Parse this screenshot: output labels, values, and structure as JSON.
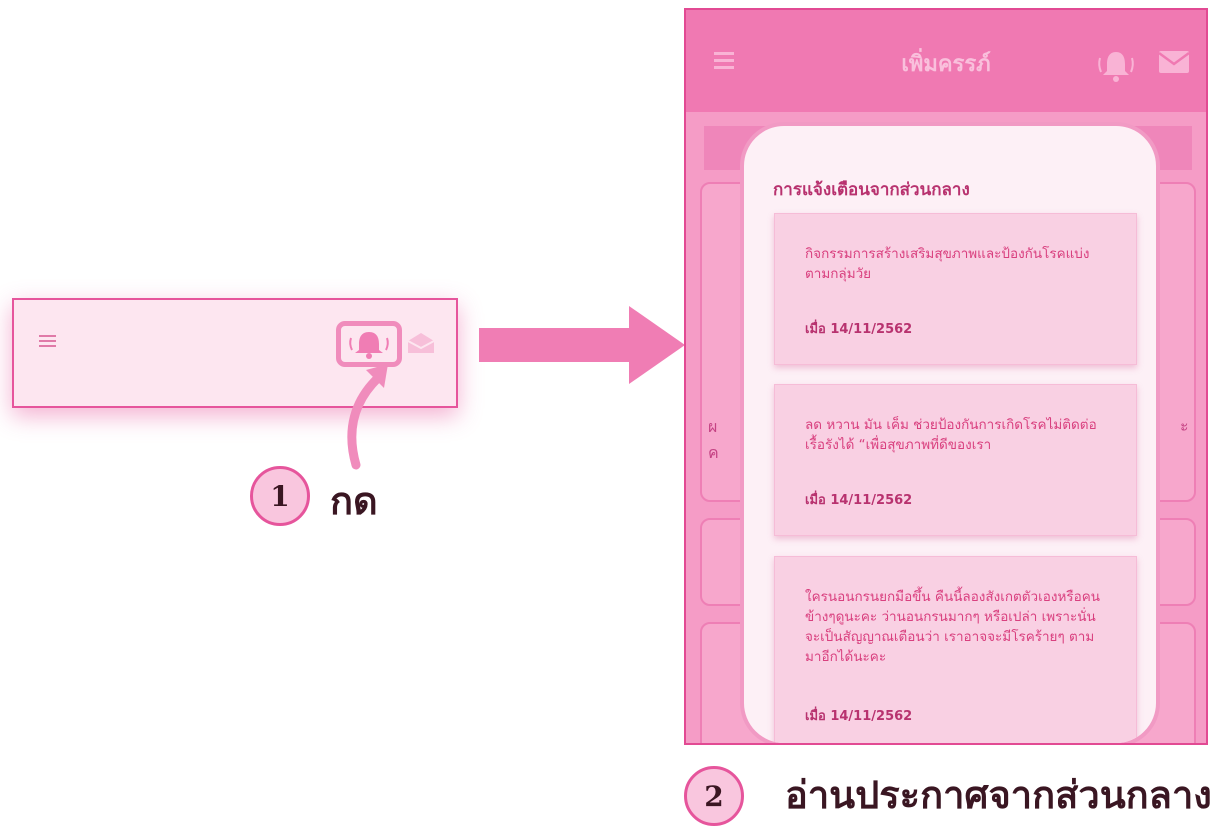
{
  "colors": {
    "accent": "#e6559c",
    "light_pink": "#fde6f0",
    "header_pink": "#f079b2",
    "text_dark_pink": "#b8326f"
  },
  "icons": {
    "menu": "hamburger-icon",
    "notifications": "bell-icon",
    "mail": "mail-icon"
  },
  "annotations": {
    "step1": {
      "number": "1",
      "text": "กด"
    },
    "step2": {
      "number": "2",
      "text": "อ่านประกาศจากส่วนกลาง"
    }
  },
  "phone": {
    "app_title": "เพิ่มครรภ์",
    "background": {
      "left_fragment": "ผ\nค",
      "right_fragment": "ะ"
    },
    "modal": {
      "title": "การแจ้งเตือนจากส่วนกลาง",
      "notices": [
        {
          "text": "กิจกรรมการสร้างเสริมสุขภาพและป้องกันโรคแบ่งตามกลุ่มวัย",
          "date": "เมื่อ 14/11/2562"
        },
        {
          "text": "ลด หวาน มัน เค็ม ช่วยป้องกันการเกิดโรคไม่ติดต่อเรื้อรังได้ “เพื่อสุขภาพที่ดีของเรา",
          "date": "เมื่อ 14/11/2562"
        },
        {
          "text": "ใครนอนกรนยกมือขึ้น คืนนี้ลองสังเกตตัวเองหรือคนข้างๆดูนะคะ ว่านอนกรนมากๆ หรือเปล่า เพราะนั่นจะเป็นสัญญาณเตือนว่า เราอาจจะมีโรคร้ายๆ ตามมาอีกได้นะคะ",
          "date": "เมื่อ 14/11/2562"
        }
      ]
    }
  }
}
